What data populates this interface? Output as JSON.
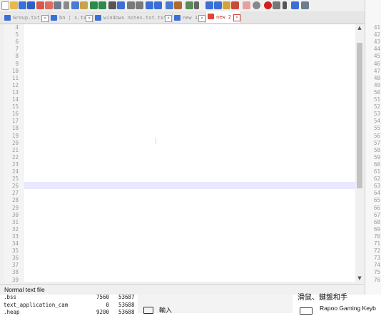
{
  "tabs": [
    {
      "label": "Group.txt",
      "active": false
    },
    {
      "label": "bn ¦ s.txt",
      "active": false
    },
    {
      "label": "windows notes.txt.txt",
      "active": false
    },
    {
      "label": "new 1",
      "active": false
    },
    {
      "label": "new 2",
      "active": true
    }
  ],
  "close_glyph": "×",
  "line_numbers": [
    "4",
    "5",
    "6",
    "7",
    "8",
    "9",
    "10",
    "11",
    "12",
    "13",
    "14",
    "15",
    "16",
    "17",
    "18",
    "19",
    "20",
    "21",
    "22",
    "23",
    "24",
    "25",
    "26",
    "27",
    "28",
    "29",
    "30",
    "31",
    "32",
    "33",
    "34",
    "35",
    "36",
    "37",
    "38",
    "39"
  ],
  "current_line": "26",
  "scrollbar": {
    "up_arrow": "▲",
    "down_arrow": "▼"
  },
  "status_bar": {
    "file_type": "Normal text file"
  },
  "right_pane": {
    "line_numbers": [
      "41",
      "42",
      "43",
      "44",
      "45",
      "46",
      "47",
      "48",
      "49",
      "50",
      "51",
      "52",
      "53",
      "54",
      "55",
      "56",
      "57",
      "58",
      "59",
      "60",
      "61",
      "62",
      "63",
      "64",
      "65",
      "66",
      "67",
      "68",
      "69",
      "70",
      "71",
      "72",
      "73",
      "74",
      "75",
      "76"
    ]
  },
  "sections_panel": {
    "rows": [
      {
        "name": ".bss",
        "size": "7560",
        "addr": "53687"
      },
      {
        "name": "text_application_cam",
        "size": "0",
        "addr": "53688"
      },
      {
        "name": ".heap",
        "size": "9200",
        "addr": "53688"
      }
    ]
  },
  "settings_panel": {
    "input_label": "輸入",
    "section_heading": "滑鼠、鍵盤和手",
    "device_name": "Rapoo Gaming Keyb"
  },
  "colors": {
    "active_tab_text": "#c0392b",
    "current_line_highlight": "#e8e8ff",
    "tab_disk": "#3b6fd6"
  }
}
